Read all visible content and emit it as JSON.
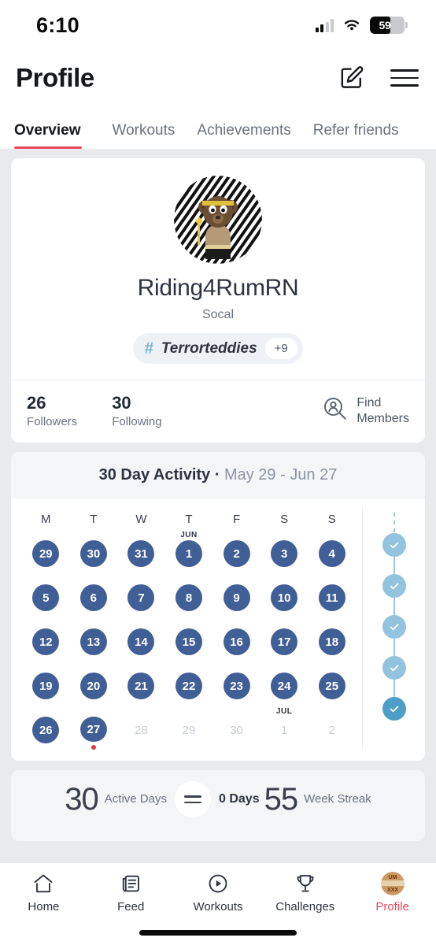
{
  "status_bar": {
    "time": "6:10",
    "battery_level": "59",
    "signal_icon": "cellular-bars-icon",
    "wifi_icon": "wifi-icon",
    "battery_icon": "battery-icon"
  },
  "header": {
    "title": "Profile",
    "edit_icon": "edit-pencil-icon",
    "menu_icon": "hamburger-menu-icon"
  },
  "tabs": [
    {
      "label": "Overview",
      "active": true
    },
    {
      "label": "Workouts",
      "active": false
    },
    {
      "label": "Achievements",
      "active": false
    },
    {
      "label": "Refer friends",
      "active": false
    }
  ],
  "profile": {
    "avatar_icon": "bear-avatar-image",
    "username": "Riding4RumRN",
    "location": "Socal",
    "tag": {
      "hash_icon": "hashtag-icon",
      "name": "Terrorteddies",
      "more_count": "+9"
    },
    "followers_count": "26",
    "followers_label": "Followers",
    "following_count": "30",
    "following_label": "Following",
    "find_members": {
      "icon": "find-members-icon",
      "line1": "Find",
      "line2": "Members"
    }
  },
  "activity": {
    "title": "30 Day Activity",
    "separator": " · ",
    "date_range": "May 29 - Jun 27",
    "day_headers": [
      "M",
      "T",
      "W",
      "T",
      "F",
      "S",
      "S"
    ],
    "weeks": [
      [
        {
          "day": "29",
          "active": true,
          "month": ""
        },
        {
          "day": "30",
          "active": true,
          "month": ""
        },
        {
          "day": "31",
          "active": true,
          "month": ""
        },
        {
          "day": "1",
          "active": true,
          "month": "JUN"
        },
        {
          "day": "2",
          "active": true,
          "month": ""
        },
        {
          "day": "3",
          "active": true,
          "month": ""
        },
        {
          "day": "4",
          "active": true,
          "month": ""
        }
      ],
      [
        {
          "day": "5",
          "active": true,
          "month": ""
        },
        {
          "day": "6",
          "active": true,
          "month": ""
        },
        {
          "day": "7",
          "active": true,
          "month": ""
        },
        {
          "day": "8",
          "active": true,
          "month": ""
        },
        {
          "day": "9",
          "active": true,
          "month": ""
        },
        {
          "day": "10",
          "active": true,
          "month": ""
        },
        {
          "day": "11",
          "active": true,
          "month": ""
        }
      ],
      [
        {
          "day": "12",
          "active": true,
          "month": ""
        },
        {
          "day": "13",
          "active": true,
          "month": ""
        },
        {
          "day": "14",
          "active": true,
          "month": ""
        },
        {
          "day": "15",
          "active": true,
          "month": ""
        },
        {
          "day": "16",
          "active": true,
          "month": ""
        },
        {
          "day": "17",
          "active": true,
          "month": ""
        },
        {
          "day": "18",
          "active": true,
          "month": ""
        }
      ],
      [
        {
          "day": "19",
          "active": true,
          "month": ""
        },
        {
          "day": "20",
          "active": true,
          "month": ""
        },
        {
          "day": "21",
          "active": true,
          "month": ""
        },
        {
          "day": "22",
          "active": true,
          "month": ""
        },
        {
          "day": "23",
          "active": true,
          "month": ""
        },
        {
          "day": "24",
          "active": true,
          "month": ""
        },
        {
          "day": "25",
          "active": true,
          "month": ""
        }
      ],
      [
        {
          "day": "26",
          "active": true,
          "month": ""
        },
        {
          "day": "27",
          "active": true,
          "month": "",
          "today": true
        },
        {
          "day": "28",
          "active": false,
          "month": ""
        },
        {
          "day": "29",
          "active": false,
          "month": ""
        },
        {
          "day": "30",
          "active": false,
          "month": ""
        },
        {
          "day": "1",
          "active": false,
          "month": "JUL"
        },
        {
          "day": "2",
          "active": false,
          "month": ""
        }
      ]
    ],
    "streak_marks": [
      {
        "icon": "check-icon",
        "completed": true
      },
      {
        "icon": "check-icon",
        "completed": true
      },
      {
        "icon": "check-icon",
        "completed": true
      },
      {
        "icon": "check-icon",
        "completed": true
      },
      {
        "icon": "check-icon",
        "completed": true,
        "current": true
      }
    ]
  },
  "summary_stats": [
    {
      "value": "30",
      "label": "Active Days"
    },
    {
      "value": "0 Days",
      "label": "",
      "icon": "equals-badge-icon"
    },
    {
      "value": "55",
      "label": "Week Streak"
    }
  ],
  "bottom_nav": [
    {
      "label": "Home",
      "icon": "home-icon",
      "active": false
    },
    {
      "label": "Feed",
      "icon": "feed-icon",
      "active": false
    },
    {
      "label": "Workouts",
      "icon": "play-circle-icon",
      "active": false
    },
    {
      "label": "Challenges",
      "icon": "trophy-icon",
      "active": false
    },
    {
      "label": "Profile",
      "icon": "profile-avatar-icon",
      "active": true
    }
  ],
  "colors": {
    "accent_red": "#e8485a",
    "calendar_blue": "#3f5f96",
    "streak_blue": "#93c3de",
    "streak_current": "#4f9ec7",
    "today_dot": "#e23b3b"
  }
}
